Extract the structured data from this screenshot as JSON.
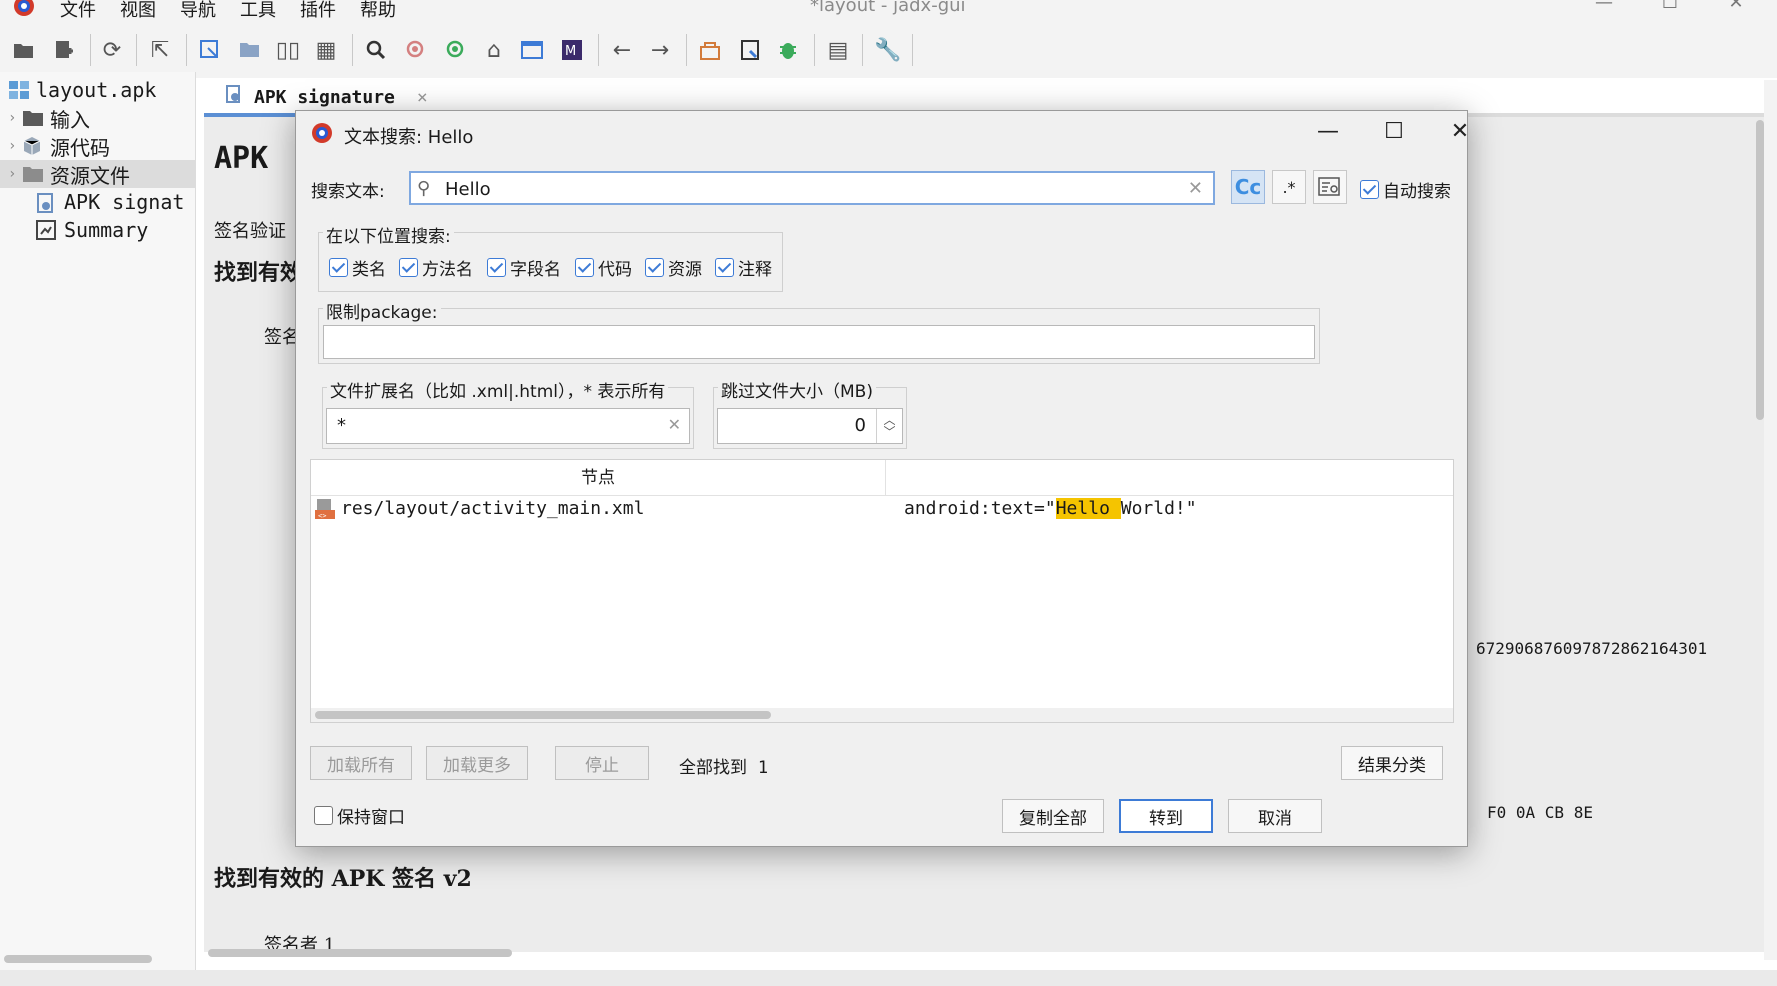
{
  "window": {
    "title": "*layout - jadx-gui",
    "menu": [
      "文件",
      "视图",
      "导航",
      "工具",
      "插件",
      "帮助"
    ]
  },
  "toolbar": {
    "icons": [
      "open-file-icon",
      "add-files-icon",
      "sync-icon",
      "export-icon",
      "select-class-icon",
      "sync-tree-icon",
      "flatten-icon",
      "table-icon",
      "search-icon",
      "find-class-icon",
      "find-usage-icon",
      "home-icon",
      "window-icon",
      "mark-icon",
      "back-icon",
      "forward-icon",
      "deobfuscation-icon",
      "quark-icon",
      "debug-icon",
      "log-icon",
      "preferences-icon"
    ]
  },
  "tree": {
    "root": "layout.apk",
    "items": [
      {
        "label": "输入",
        "icon": "folder-input-icon"
      },
      {
        "label": "源代码",
        "icon": "package-icon"
      },
      {
        "label": "资源文件",
        "icon": "resources-folder-icon"
      },
      {
        "label": "APK signat",
        "icon": "certificate-icon"
      },
      {
        "label": "Summary",
        "icon": "summary-icon"
      }
    ]
  },
  "tab": {
    "label": "APK signature",
    "close": "×"
  },
  "content": {
    "heading": "APK",
    "verify_label": "签名验证",
    "found_v1_partial": "找到有效",
    "signer_partial": "签名",
    "hex_line": "672906876097872862164301",
    "hex_bytes": "F0 0A CB 8E",
    "found_v2": "找到有效的 APK 签名 v2",
    "signer_1": "签名者 1"
  },
  "dialog": {
    "title": "文本搜索: Hello",
    "search_label": "搜索文本:",
    "search_value": "Hello",
    "case_btn": "Cc",
    "regex_btn": ".*",
    "auto_search": {
      "label": "自动搜索",
      "checked": true
    },
    "search_in": {
      "legend": "在以下位置搜索:",
      "options": [
        {
          "label": "类名",
          "checked": true
        },
        {
          "label": "方法名",
          "checked": true
        },
        {
          "label": "字段名",
          "checked": true
        },
        {
          "label": "代码",
          "checked": true
        },
        {
          "label": "资源",
          "checked": true
        },
        {
          "label": "注释",
          "checked": true
        }
      ]
    },
    "package_limit": {
      "legend": "限制package:",
      "value": ""
    },
    "file_ext": {
      "legend": "文件扩展名（比如 .xml|.html），* 表示所有",
      "value": "*"
    },
    "skip_size": {
      "legend": "跳过文件大小（MB)",
      "value": "0"
    },
    "results": {
      "col_node": "节点",
      "col_code": "",
      "rows": [
        {
          "node": "res/layout/activity_main.xml",
          "code_before": "android:text=\"",
          "code_match": "Hello ",
          "code_after": "World!\""
        }
      ]
    },
    "buttons": {
      "load_all": "加载所有",
      "load_more": "加载更多",
      "stop": "停止",
      "found_label": "全部找到",
      "found_count": "1",
      "sort": "结果分类",
      "keep_window": "保持窗口",
      "copy_all": "复制全部",
      "goto": "转到",
      "cancel": "取消"
    }
  }
}
